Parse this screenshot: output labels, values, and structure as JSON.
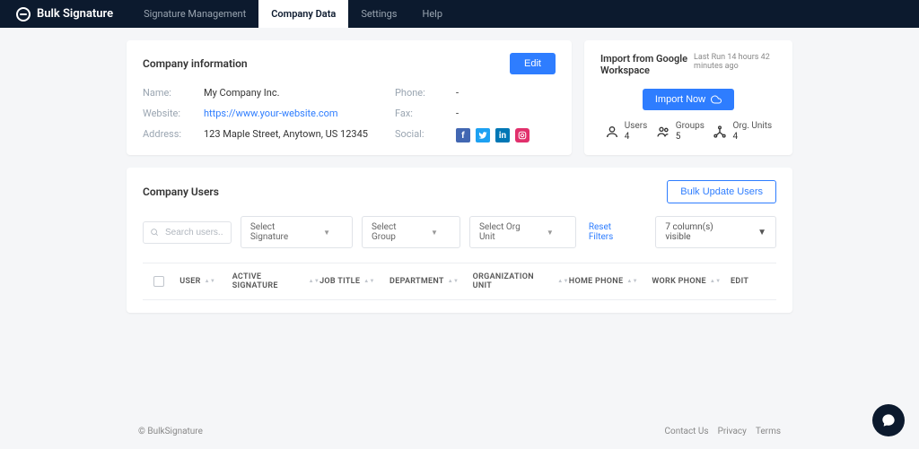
{
  "brand": "Bulk Signature",
  "nav": {
    "items": [
      "Signature Management",
      "Company Data",
      "Settings",
      "Help"
    ],
    "activeIndex": 1
  },
  "company": {
    "title": "Company information",
    "editLabel": "Edit",
    "fields": {
      "nameLabel": "Name:",
      "nameValue": "My Company Inc.",
      "websiteLabel": "Website:",
      "websiteValue": "https://www.your-website.com",
      "addressLabel": "Address:",
      "addressValue": "123 Maple Street, Anytown, US 12345",
      "phoneLabel": "Phone:",
      "phoneValue": "-",
      "faxLabel": "Fax:",
      "faxValue": "-",
      "socialLabel": "Social:"
    }
  },
  "import": {
    "title": "Import from Google Workspace",
    "lastRun": "Last Run 14 hours 42 minutes ago",
    "importLabel": "Import Now",
    "stats": {
      "usersLabel": "Users",
      "usersValue": "4",
      "groupsLabel": "Groups",
      "groupsValue": "5",
      "orgLabel": "Org. Units",
      "orgValue": "4"
    }
  },
  "users": {
    "title": "Company Users",
    "bulkLabel": "Bulk Update Users",
    "searchPlaceholder": "Search users...",
    "filters": {
      "signature": "Select Signature",
      "group": "Select Group",
      "org": "Select Org Unit",
      "reset": "Reset Filters",
      "columns": "7 column(s) visible"
    },
    "columns": [
      "USER",
      "ACTIVE SIGNATURE",
      "JOB TITLE",
      "DEPARTMENT",
      "ORGANIZATION UNIT",
      "HOME PHONE",
      "WORK PHONE",
      "EDIT"
    ]
  },
  "footer": {
    "copyright": "© BulkSignature",
    "links": [
      "Contact Us",
      "Privacy",
      "Terms"
    ]
  }
}
